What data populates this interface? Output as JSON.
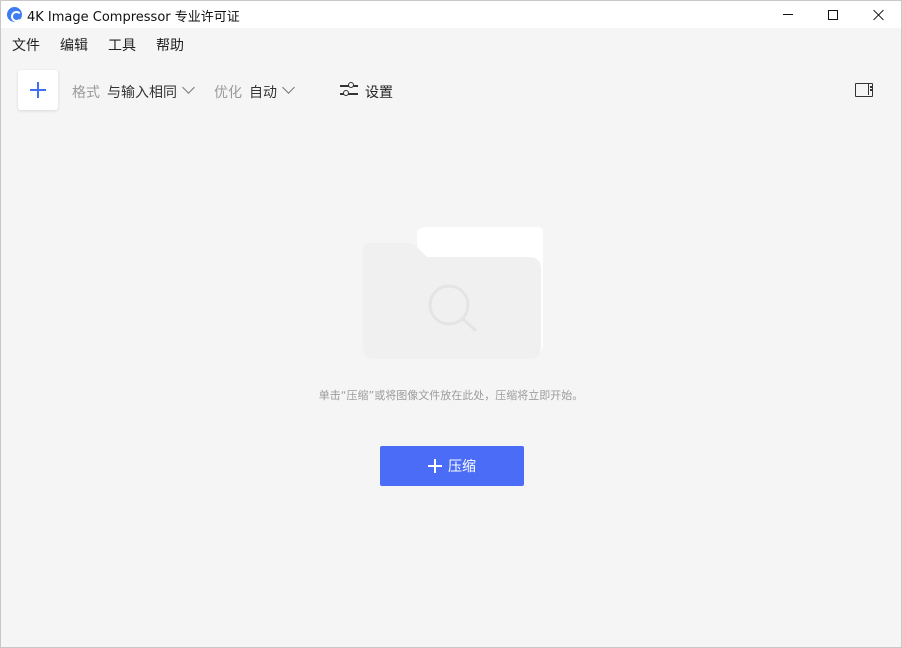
{
  "window": {
    "title": "4K Image Compressor 专业许可证"
  },
  "menu": {
    "file": "文件",
    "edit": "编辑",
    "tools": "工具",
    "help": "帮助"
  },
  "toolbar": {
    "format_label": "格式",
    "format_value": "与输入相同",
    "optimize_label": "优化",
    "optimize_value": "自动",
    "settings_label": "设置"
  },
  "empty_state": {
    "hint": "单击“压缩”或将图像文件放在此处，压缩将立即开始。",
    "compress_button": "压缩"
  },
  "icons": {
    "app": "app-logo-icon",
    "add": "plus-icon",
    "settings": "sliders-icon",
    "panel": "side-panel-icon",
    "empty": "folder-search-icon"
  },
  "colors": {
    "accent": "#4a6cf7",
    "plus": "#3f6ff5",
    "background": "#f5f5f5"
  }
}
